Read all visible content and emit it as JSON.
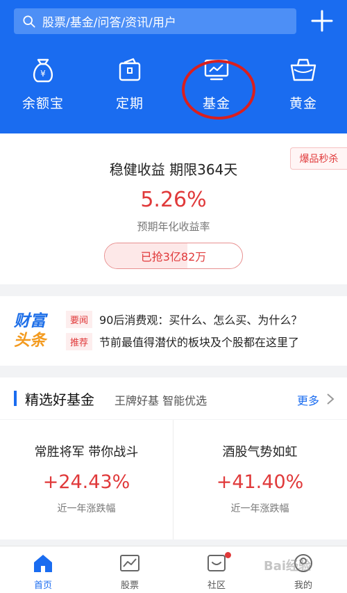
{
  "search": {
    "placeholder": "股票/基金/问答/资讯/用户"
  },
  "quick_nav": [
    {
      "label": "余额宝",
      "icon": "money-bag-icon"
    },
    {
      "label": "定期",
      "icon": "wallet-icon"
    },
    {
      "label": "基金",
      "icon": "fund-chart-icon"
    },
    {
      "label": "黄金",
      "icon": "gold-basket-icon"
    }
  ],
  "product": {
    "badge": "爆品秒杀",
    "title": "稳健收益 期限364天",
    "rate": "5.26%",
    "rate_label": "预期年化收益率",
    "sold": "已抢3亿82万",
    "sold_progress": 0.6
  },
  "news": {
    "logo_line1": "财富",
    "logo_line2": "头条",
    "items": [
      {
        "tag": "要闻",
        "text": "90后消费观：买什么、怎么买、为什么？"
      },
      {
        "tag": "推荐",
        "text": "节前最值得潜伏的板块及个股都在这里了"
      }
    ]
  },
  "featured": {
    "title": "精选好基金",
    "subtitle": "王牌好基 智能优选",
    "more": "更多"
  },
  "funds": [
    {
      "title": "常胜将军 带你战斗",
      "value": "+24.43%",
      "label": "近一年涨跌幅"
    },
    {
      "title": "酒股气势如虹",
      "value": "+41.40%",
      "label": "近一年涨跌幅"
    }
  ],
  "tabs": [
    {
      "label": "首页",
      "icon": "home-icon"
    },
    {
      "label": "股票",
      "icon": "stock-chart-icon"
    },
    {
      "label": "社区",
      "icon": "community-icon"
    },
    {
      "label": "我的",
      "icon": "profile-icon"
    }
  ],
  "colors": {
    "brand_blue": "#1a6cf0",
    "accent_red": "#e0393a",
    "highlight_circle": "#d91f1f"
  },
  "watermark": "Bai经验"
}
